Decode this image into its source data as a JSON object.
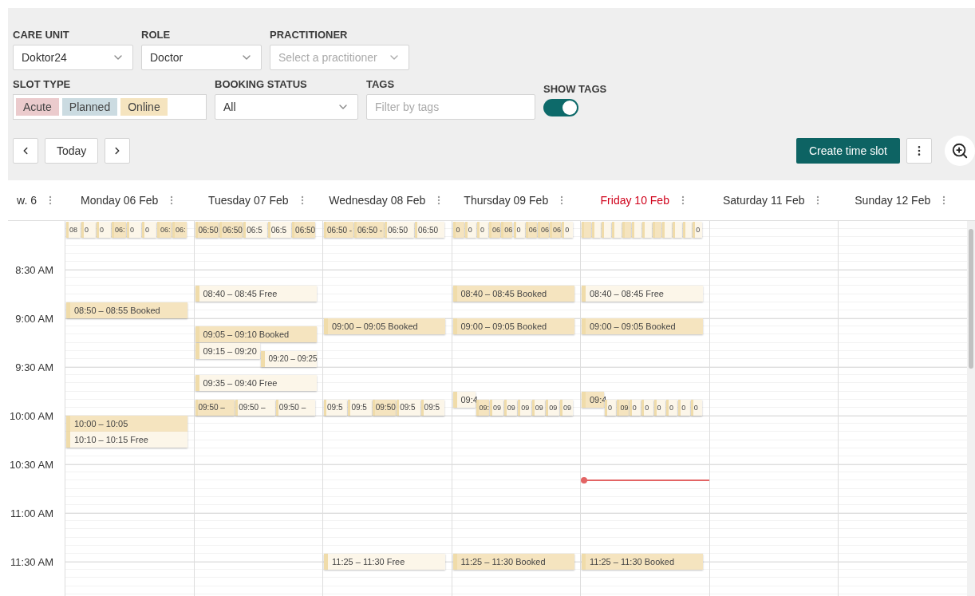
{
  "filters": {
    "care_unit": {
      "label": "CARE UNIT",
      "value": "Doktor24"
    },
    "role": {
      "label": "ROLE",
      "value": "Doctor"
    },
    "practitioner": {
      "label": "PRACTITIONER",
      "placeholder": "Select a practitioner"
    },
    "slot_type": {
      "label": "SLOT TYPE",
      "tags": [
        {
          "label": "Acute",
          "color": "#ebcbcd"
        },
        {
          "label": "Planned",
          "color": "#cbdbe1"
        },
        {
          "label": "Online",
          "color": "#f5e4bf"
        }
      ]
    },
    "booking_status": {
      "label": "BOOKING STATUS",
      "value": "All"
    },
    "tags": {
      "label": "TAGS",
      "placeholder": "Filter by tags"
    },
    "show_tags": {
      "label": "SHOW TAGS",
      "on": true
    }
  },
  "toolbar": {
    "today": "Today",
    "create": "Create time slot"
  },
  "calendar": {
    "week": "w. 6",
    "time_labels": [
      "8:30 AM",
      "9:00 AM",
      "9:30 AM",
      "10:00 AM",
      "10:30 AM",
      "11:00 AM",
      "11:30 AM"
    ],
    "days": [
      {
        "label": "Monday 06 Feb",
        "today": false,
        "groups": [
          {
            "slots": [
              {
                "label": "08",
                "booked": false
              },
              {
                "label": "0",
                "booked": false
              },
              {
                "label": "0",
                "booked": false
              },
              {
                "label": "06:",
                "booked": true
              },
              {
                "label": "0",
                "booked": false
              },
              {
                "label": "0",
                "booked": false
              },
              {
                "label": "06:",
                "booked": true
              },
              {
                "label": "06:",
                "booked": true
              }
            ]
          },
          {
            "slots": [
              {
                "label": "08:50 – 08:55  Booked",
                "booked": true
              }
            ]
          },
          {
            "slots": [
              {
                "label": "10:00 – 10:05",
                "booked": true
              }
            ]
          },
          {
            "slots": [
              {
                "label": "10:10 – 10:15  Free",
                "booked": false
              }
            ]
          }
        ]
      },
      {
        "label": "Tuesday 07 Feb",
        "today": false,
        "groups": [
          {
            "slots": [
              {
                "label": "06:50",
                "booked": true
              },
              {
                "label": "06:50",
                "booked": true
              },
              {
                "label": "06:5",
                "booked": false
              },
              {
                "label": "06:5",
                "booked": false
              },
              {
                "label": "06:50",
                "booked": true
              }
            ]
          },
          {
            "slots": [
              {
                "label": "08:40 – 08:45  Free",
                "booked": false
              }
            ]
          },
          {
            "slots": [
              {
                "label": "09:05 – 09:10  Booked",
                "booked": true
              }
            ]
          },
          {
            "slots": [
              {
                "label": "09:15 – 09:20",
                "booked": false
              }
            ]
          },
          {
            "slots": [
              {
                "label": "09:20 – 09:25",
                "booked": false
              }
            ]
          },
          {
            "slots": [
              {
                "label": "09:35 – 09:40  Free",
                "booked": false
              }
            ]
          },
          {
            "slots": [
              {
                "label": "09:50 –",
                "booked": true
              },
              {
                "label": "09:50 –",
                "booked": false
              },
              {
                "label": "09:50 –",
                "booked": false
              }
            ]
          }
        ]
      },
      {
        "label": "Wednesday 08 Feb",
        "today": false,
        "groups": [
          {
            "slots": [
              {
                "label": "06:50 -",
                "booked": true
              },
              {
                "label": "06:50 -",
                "booked": true
              },
              {
                "label": "06:50",
                "booked": false
              },
              {
                "label": "06:50",
                "booked": false
              }
            ]
          },
          {
            "slots": [
              {
                "label": "09:00 – 09:05  Booked",
                "booked": true
              }
            ]
          },
          {
            "slots": [
              {
                "label": "09:5",
                "booked": false
              },
              {
                "label": "09:5",
                "booked": false
              },
              {
                "label": "09:50",
                "booked": true
              },
              {
                "label": "09:5",
                "booked": false
              },
              {
                "label": "09:5",
                "booked": false
              }
            ]
          },
          {
            "slots": [
              {
                "label": "11:25 – 11:30  Free",
                "booked": false
              }
            ]
          }
        ]
      },
      {
        "label": "Thursday 09 Feb",
        "today": false,
        "groups": [
          {
            "slots": [
              {
                "label": "0",
                "booked": true
              },
              {
                "label": "0",
                "booked": false
              },
              {
                "label": "0",
                "booked": false
              },
              {
                "label": "06",
                "booked": true
              },
              {
                "label": "06",
                "booked": true
              },
              {
                "label": "0",
                "booked": false
              },
              {
                "label": "06",
                "booked": true
              },
              {
                "label": "06",
                "booked": true
              },
              {
                "label": "06",
                "booked": true
              },
              {
                "label": "0",
                "booked": false
              }
            ]
          },
          {
            "slots": [
              {
                "label": "08:40 – 08:45  Booked",
                "booked": true
              }
            ]
          },
          {
            "slots": [
              {
                "label": "09:00 – 09:05  Booked",
                "booked": true
              }
            ]
          },
          {
            "slots": [
              {
                "label": "09:4",
                "booked": false
              }
            ]
          },
          {
            "slots": [
              {
                "label": "09:",
                "booked": true
              },
              {
                "label": "09",
                "booked": false
              },
              {
                "label": "09",
                "booked": false
              },
              {
                "label": "09",
                "booked": false
              },
              {
                "label": "09",
                "booked": false
              },
              {
                "label": "09",
                "booked": false
              },
              {
                "label": "09",
                "booked": false
              }
            ]
          },
          {
            "slots": [
              {
                "label": "11:25 – 11:30  Booked",
                "booked": true
              }
            ]
          }
        ]
      },
      {
        "label": "Friday 10 Feb",
        "today": true,
        "groups": [
          {
            "slots": [
              {
                "booked": true
              },
              {
                "booked": false
              },
              {
                "booked": false
              },
              {
                "booked": false
              },
              {
                "booked": true
              },
              {
                "booked": false
              },
              {
                "booked": false
              },
              {
                "booked": true
              },
              {
                "booked": false
              },
              {
                "booked": false
              },
              {
                "booked": false
              },
              {
                "label": "0",
                "booked": false
              }
            ]
          },
          {
            "slots": [
              {
                "label": "08:40 – 08:45  Free",
                "booked": false
              }
            ]
          },
          {
            "slots": [
              {
                "label": "09:00 – 09:05  Booked",
                "booked": true
              }
            ]
          },
          {
            "slots": [
              {
                "label": "09:4",
                "booked": true
              }
            ]
          },
          {
            "slots": [
              {
                "label": "0",
                "booked": false
              },
              {
                "label": "09",
                "booked": true
              },
              {
                "label": "0",
                "booked": false
              },
              {
                "label": "0",
                "booked": false
              },
              {
                "label": "0",
                "booked": false
              },
              {
                "label": "0",
                "booked": false
              },
              {
                "label": "0",
                "booked": false
              },
              {
                "label": "0",
                "booked": false
              }
            ]
          },
          {
            "slots": [
              {
                "label": "11:25 – 11:30  Booked",
                "booked": true
              }
            ]
          }
        ]
      },
      {
        "label": "Saturday 11 Feb",
        "today": false
      },
      {
        "label": "Sunday 12 Feb",
        "today": false
      }
    ]
  }
}
